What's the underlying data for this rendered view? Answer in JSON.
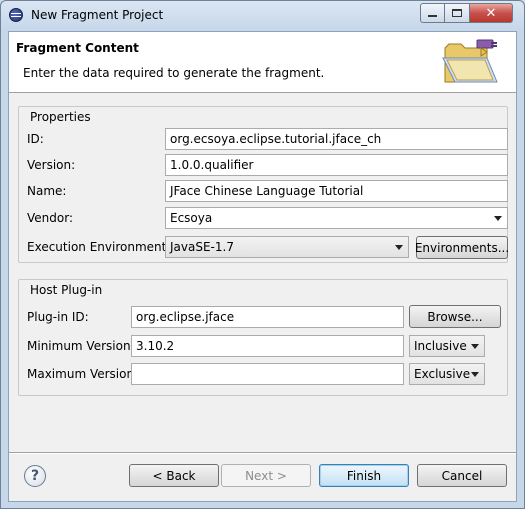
{
  "window": {
    "title": "New Fragment Project"
  },
  "header": {
    "title": "Fragment Content",
    "description": "Enter the data required to generate the fragment."
  },
  "properties": {
    "group_title": "Properties",
    "id_label": "ID:",
    "id_value": "org.ecsoya.eclipse.tutorial.jface_ch",
    "version_label": "Version:",
    "version_value": "1.0.0.qualifier",
    "name_label": "Name:",
    "name_value": "JFace Chinese Language Tutorial",
    "vendor_label": "Vendor:",
    "vendor_value": "Ecsoya",
    "exec_env_label": "Execution Environment:",
    "exec_env_value": "JavaSE-1.7",
    "environments_button": "Environments..."
  },
  "host": {
    "group_title": "Host Plug-in",
    "plugin_id_label": "Plug-in ID:",
    "plugin_id_value": "org.eclipse.jface",
    "browse_button": "Browse...",
    "min_version_label": "Minimum Version:",
    "min_version_value": "3.10.2",
    "min_inclusive_value": "Inclusive",
    "max_version_label": "Maximum Version:",
    "max_version_value": "",
    "max_inclusive_value": "Exclusive"
  },
  "buttons": {
    "back": "< Back",
    "next": "Next >",
    "finish": "Finish",
    "cancel": "Cancel",
    "help": "?"
  },
  "icons": {
    "app": "eclipse-icon",
    "minimize": "minimize-icon",
    "maximize": "maximize-icon",
    "close": "close-icon",
    "wizard": "folder-plug-icon",
    "help": "help-icon"
  }
}
